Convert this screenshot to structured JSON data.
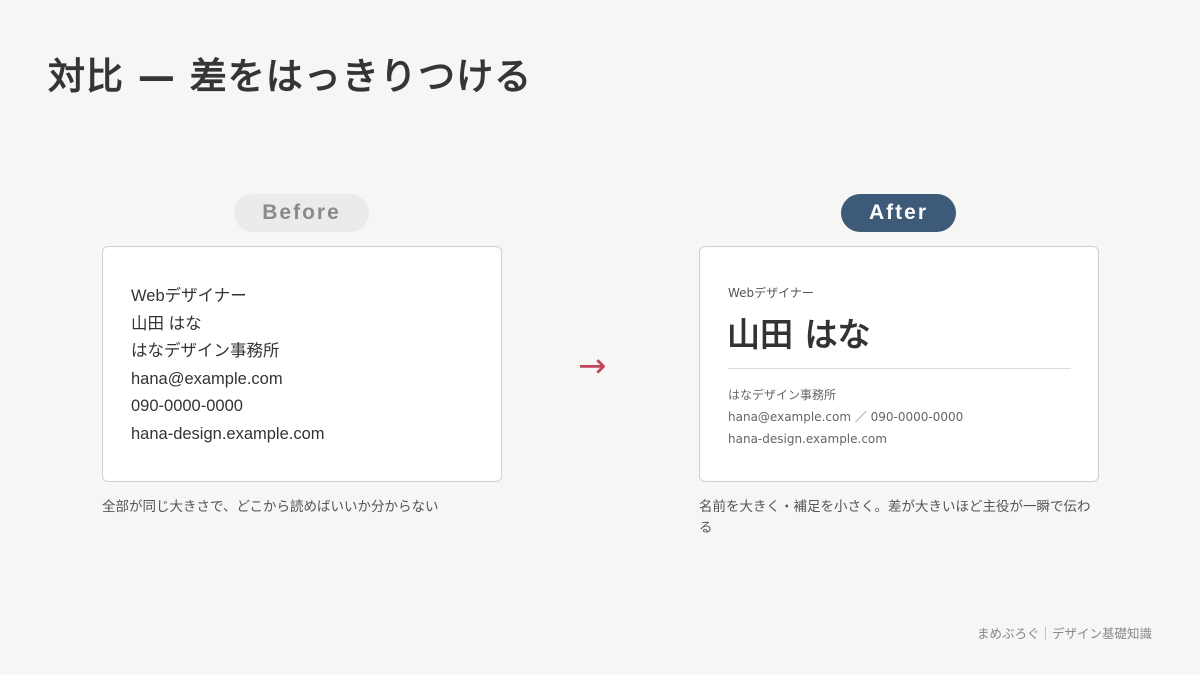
{
  "title": "対比 — 差をはっきりつける",
  "before": {
    "label": "Before",
    "lines": [
      "Webデザイナー",
      "山田 はな",
      "はなデザイン事務所",
      "hana@example.com",
      "090-0000-0000",
      "hana-design.example.com"
    ],
    "caption": "全部が同じ大きさで、どこから読めばいいか分からない"
  },
  "arrow": "→",
  "after": {
    "label": "After",
    "role": "Webデザイナー",
    "name": "山田 はな",
    "details": [
      "はなデザイン事務所",
      "hana@example.com ／ 090-0000-0000",
      "hana-design.example.com"
    ],
    "caption": "名前を大きく・補足を小さく。差が大きいほど主役が一瞬で伝わる"
  },
  "footer": "まめぶろぐ｜デザイン基礎知識",
  "colors": {
    "background": "#f6f6f4",
    "after_pill": "#3d5a79",
    "before_pill": "#ebebea",
    "arrow": "#c0485a"
  }
}
